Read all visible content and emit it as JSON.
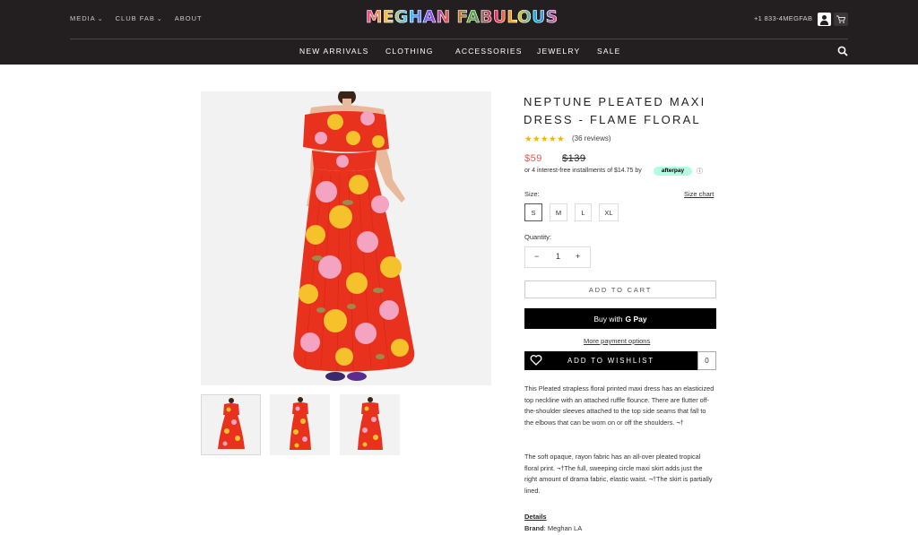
{
  "header": {
    "top_links": [
      "MEDIA",
      "CLUB FAB",
      "ABOUT"
    ],
    "logo": "MEGHAN FABULOUS",
    "phone": "+1 833-4MEGFAB",
    "nav": [
      "NEW ARRIVALS",
      "CLOTHING",
      "ACCESSORIES",
      "JEWELRY",
      "SALE"
    ]
  },
  "product": {
    "title": "NEPTUNE PLEATED MAXI DRESS - FLAME FLORAL",
    "stars": "★★★★★",
    "rating": 5,
    "reviews": "(36 reviews)",
    "price": "$59",
    "compare_price": "$139",
    "installments": "or 4 interest-free installments of $14.75 by",
    "afterpay": "afterpay",
    "info_icon": "ⓘ",
    "size_label": "Size:",
    "size_chart": "Size chart",
    "sizes": [
      "S",
      "M",
      "L",
      "XL"
    ],
    "selected_size": "S",
    "qty_label": "Quantity:",
    "qty": "1",
    "minus": "−",
    "plus": "+",
    "add_to_cart": "ADD TO CART",
    "buy_with": "Buy with",
    "gpay": "G Pay",
    "more_payment": "More payment options",
    "wishlist": "ADD TO WISHLIST",
    "wishlist_count": "0",
    "description": [
      "This Pleated strapless floral printed maxi dress has an elasticized top neckline with an attached ruffle flounce. There are flutter off-the-shoulder sleeves attached to the top side seams that fall to the elbows that can be worn on or off the shoulders. ¬†",
      "The soft opaque, rayon fabric has an all-over pleated tropical floral print. ¬†The full, sweeping circle maxi skirt adds just the right amount of drama fabric, elastic waist. ¬†The skirt is partially lined."
    ],
    "details_heading": "Details",
    "brand_label": "Brand",
    "brand_value": ": Meghan LA"
  },
  "colors": {
    "header_bg": "#231f20",
    "sale_price": "#e4594b",
    "dress_red": "#e8321e",
    "flower_yellow": "#f5c22b",
    "flower_pink": "#f4a3c0"
  }
}
